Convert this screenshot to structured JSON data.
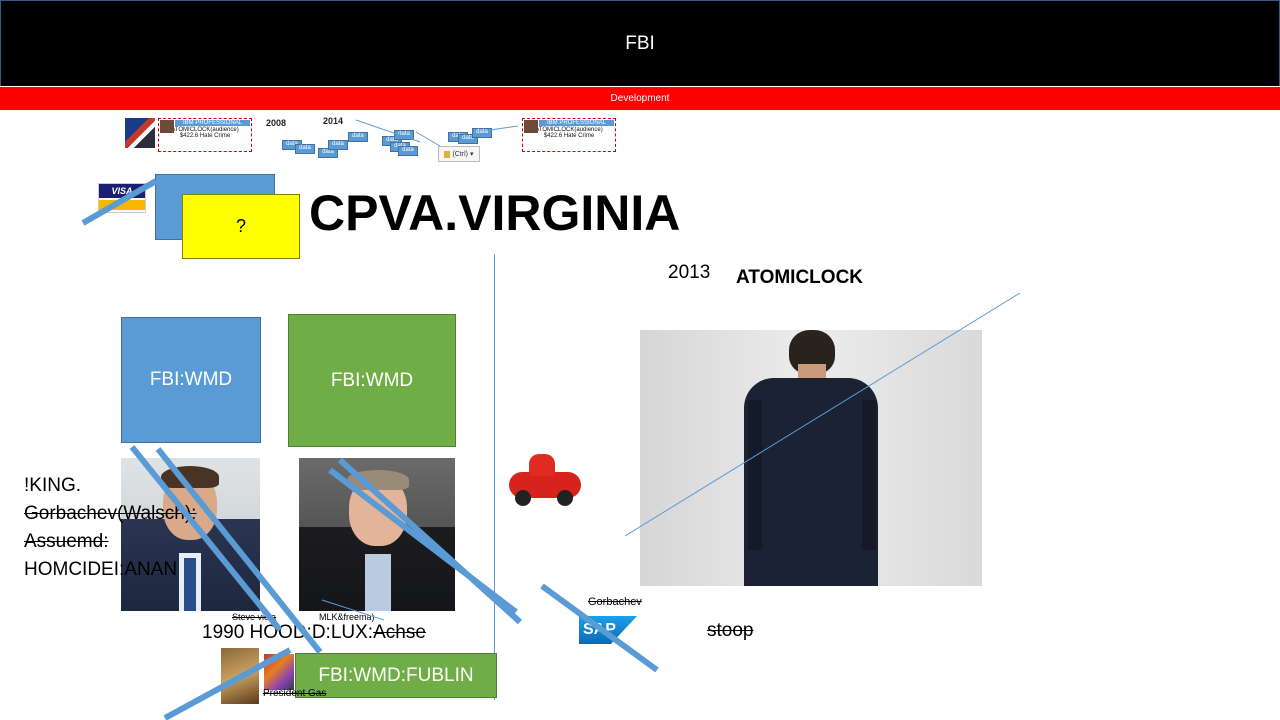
{
  "header": {
    "title": "FBI",
    "subtitle": "Development"
  },
  "timeline": {
    "card_left": {
      "title": "IBM PROFESSIONAL",
      "line1": "ATOMICLOCK(audience)",
      "line2": "$422.6 Hate Crime"
    },
    "card_right": {
      "title": "IBM PROFESSIONAL",
      "line1": "ATOMICLOCK(audience)",
      "line2": "$422.6 Hate Crime"
    },
    "year1": "2008",
    "year2": "2014",
    "mini_label": "data",
    "paste_label": "(Ctrl)"
  },
  "slide": {
    "question": "?",
    "heading": "CPVA.VIRGINIA",
    "year_2013": "2013",
    "atomiclock": "ATOMICLOCK",
    "box_blue": "FBI:WMD",
    "box_green": "FBI:WMD",
    "left_text": {
      "line1": "!KING.",
      "line2": "Gorbachev(Walsch):",
      "line3": "Assuemd:",
      "line4": "HOMCIDEI:ANAN"
    },
    "caption_steve": "Steve viola",
    "caption_mlk": "MLK&freema)",
    "hood_prefix": "1990 HOOD:D:LUX:",
    "hood_strike": "Achse",
    "gorbachev": "Gorbachev",
    "stoop": "stoop",
    "bottom_box": "FBI:WMD:FUBLIN",
    "president": "President Gas",
    "sap_logo_text": "SAP",
    "visa_logo_text": "VISA"
  },
  "colors": {
    "accent_blue": "#5b9bd5",
    "accent_green": "#70ad47",
    "bar_red": "#ff0000",
    "note_yellow": "#ffff00"
  }
}
